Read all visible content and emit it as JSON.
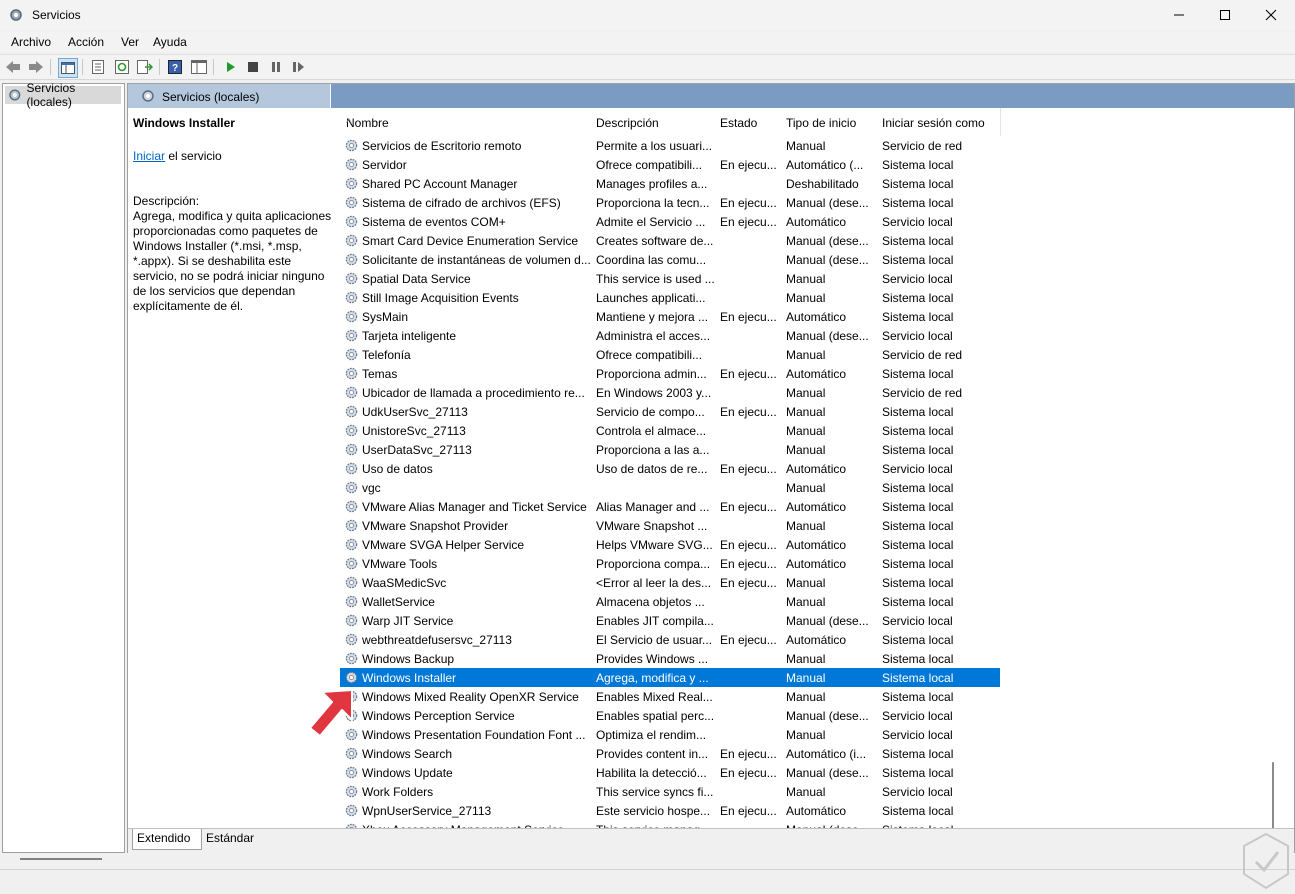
{
  "window": {
    "title": "Servicios"
  },
  "menu": [
    "Archivo",
    "Acción",
    "Ver",
    "Ayuda"
  ],
  "tree": {
    "root": "Servicios (locales)"
  },
  "main": {
    "header": "Servicios (locales)"
  },
  "details": {
    "service_title": "Windows Installer",
    "start_link": "Iniciar",
    "start_suffix": " el servicio",
    "description_label": "Descripción:",
    "description_text": "Agrega, modifica y quita aplicaciones proporcionadas como paquetes de Windows Installer (*.msi, *.msp, *.appx). Si se deshabilita este servicio, no se podrá iniciar ninguno de los servicios que dependan explícitamente de él."
  },
  "columns": {
    "name": "Nombre",
    "description": "Descripción",
    "state": "Estado",
    "startup": "Tipo de inicio",
    "logon": "Iniciar sesión como"
  },
  "services": [
    {
      "name": "Servicios de Escritorio remoto",
      "description": "Permite a los usuari...",
      "state": "",
      "startup": "Manual",
      "logon": "Servicio de red"
    },
    {
      "name": "Servidor",
      "description": "Ofrece compatibili...",
      "state": "En ejecu...",
      "startup": "Automático (...",
      "logon": "Sistema local"
    },
    {
      "name": "Shared PC Account Manager",
      "description": "Manages profiles a...",
      "state": "",
      "startup": "Deshabilitado",
      "logon": "Sistema local"
    },
    {
      "name": "Sistema de cifrado de archivos (EFS)",
      "description": "Proporciona la tecn...",
      "state": "En ejecu...",
      "startup": "Manual (dese...",
      "logon": "Sistema local"
    },
    {
      "name": "Sistema de eventos COM+",
      "description": "Admite el Servicio ...",
      "state": "En ejecu...",
      "startup": "Automático",
      "logon": "Servicio local"
    },
    {
      "name": "Smart Card Device Enumeration Service",
      "description": "Creates software de...",
      "state": "",
      "startup": "Manual (dese...",
      "logon": "Sistema local"
    },
    {
      "name": "Solicitante de instantáneas de volumen d...",
      "description": "Coordina las comu...",
      "state": "",
      "startup": "Manual (dese...",
      "logon": "Sistema local"
    },
    {
      "name": "Spatial Data Service",
      "description": "This service is used ...",
      "state": "",
      "startup": "Manual",
      "logon": "Servicio local"
    },
    {
      "name": "Still Image Acquisition Events",
      "description": "Launches applicati...",
      "state": "",
      "startup": "Manual",
      "logon": "Sistema local"
    },
    {
      "name": "SysMain",
      "description": "Mantiene y mejora ...",
      "state": "En ejecu...",
      "startup": "Automático",
      "logon": "Sistema local"
    },
    {
      "name": "Tarjeta inteligente",
      "description": "Administra el acces...",
      "state": "",
      "startup": "Manual (dese...",
      "logon": "Servicio local"
    },
    {
      "name": "Telefonía",
      "description": "Ofrece compatibili...",
      "state": "",
      "startup": "Manual",
      "logon": "Servicio de red"
    },
    {
      "name": "Temas",
      "description": "Proporciona admin...",
      "state": "En ejecu...",
      "startup": "Automático",
      "logon": "Sistema local"
    },
    {
      "name": "Ubicador de llamada a procedimiento re...",
      "description": "En Windows 2003 y...",
      "state": "",
      "startup": "Manual",
      "logon": "Servicio de red"
    },
    {
      "name": "UdkUserSvc_27113",
      "description": "Servicio de compo...",
      "state": "En ejecu...",
      "startup": "Manual",
      "logon": "Sistema local"
    },
    {
      "name": "UnistoreSvc_27113",
      "description": "Controla el almace...",
      "state": "",
      "startup": "Manual",
      "logon": "Sistema local"
    },
    {
      "name": "UserDataSvc_27113",
      "description": "Proporciona a las a...",
      "state": "",
      "startup": "Manual",
      "logon": "Sistema local"
    },
    {
      "name": "Uso de datos",
      "description": "Uso de datos de re...",
      "state": "En ejecu...",
      "startup": "Automático",
      "logon": "Servicio local"
    },
    {
      "name": "vgc",
      "description": "",
      "state": "",
      "startup": "Manual",
      "logon": "Sistema local"
    },
    {
      "name": "VMware Alias Manager and Ticket Service",
      "description": "Alias Manager and ...",
      "state": "En ejecu...",
      "startup": "Automático",
      "logon": "Sistema local"
    },
    {
      "name": "VMware Snapshot Provider",
      "description": "VMware Snapshot ...",
      "state": "",
      "startup": "Manual",
      "logon": "Sistema local"
    },
    {
      "name": "VMware SVGA Helper Service",
      "description": "Helps VMware SVG...",
      "state": "En ejecu...",
      "startup": "Automático",
      "logon": "Sistema local"
    },
    {
      "name": "VMware Tools",
      "description": "Proporciona compa...",
      "state": "En ejecu...",
      "startup": "Automático",
      "logon": "Sistema local"
    },
    {
      "name": "WaaSMedicSvc",
      "description": "<Error al leer la des...",
      "state": "En ejecu...",
      "startup": "Manual",
      "logon": "Sistema local"
    },
    {
      "name": "WalletService",
      "description": "Almacena objetos ...",
      "state": "",
      "startup": "Manual",
      "logon": "Sistema local"
    },
    {
      "name": "Warp JIT Service",
      "description": "Enables JIT compila...",
      "state": "",
      "startup": "Manual (dese...",
      "logon": "Servicio local"
    },
    {
      "name": "webthreatdefusersvc_27113",
      "description": "El Servicio de usuar...",
      "state": "En ejecu...",
      "startup": "Automático",
      "logon": "Sistema local"
    },
    {
      "name": "Windows Backup",
      "description": "Provides Windows ...",
      "state": "",
      "startup": "Manual",
      "logon": "Sistema local"
    },
    {
      "name": "Windows Installer",
      "description": "Agrega, modifica y ...",
      "state": "",
      "startup": "Manual",
      "logon": "Sistema local"
    },
    {
      "name": "Windows Mixed Reality OpenXR Service",
      "description": "Enables Mixed Real...",
      "state": "",
      "startup": "Manual",
      "logon": "Sistema local"
    },
    {
      "name": "Windows Perception Service",
      "description": "Enables spatial perc...",
      "state": "",
      "startup": "Manual (dese...",
      "logon": "Servicio local"
    },
    {
      "name": "Windows Presentation Foundation Font ...",
      "description": "Optimiza el rendim...",
      "state": "",
      "startup": "Manual",
      "logon": "Servicio local"
    },
    {
      "name": "Windows Search",
      "description": "Provides content in...",
      "state": "En ejecu...",
      "startup": "Automático (i...",
      "logon": "Sistema local"
    },
    {
      "name": "Windows Update",
      "description": "Habilita la detecció...",
      "state": "En ejecu...",
      "startup": "Manual (dese...",
      "logon": "Sistema local"
    },
    {
      "name": "Work Folders",
      "description": "This service syncs fi...",
      "state": "",
      "startup": "Manual",
      "logon": "Servicio local"
    },
    {
      "name": "WpnUserService_27113",
      "description": "Este servicio hospe...",
      "state": "En ejecu...",
      "startup": "Automático",
      "logon": "Sistema local"
    },
    {
      "name": "Xbox Accessory Management Service",
      "description": "This service manag...",
      "state": "",
      "startup": "Manual (dese...",
      "logon": "Sistema local"
    }
  ],
  "selected_index": 28,
  "tabs": [
    "Extendido",
    "Estándar"
  ],
  "colors": {
    "selection": "#0078d7",
    "header_bar": "#7a9cc2",
    "arrow": "#e0363f"
  }
}
